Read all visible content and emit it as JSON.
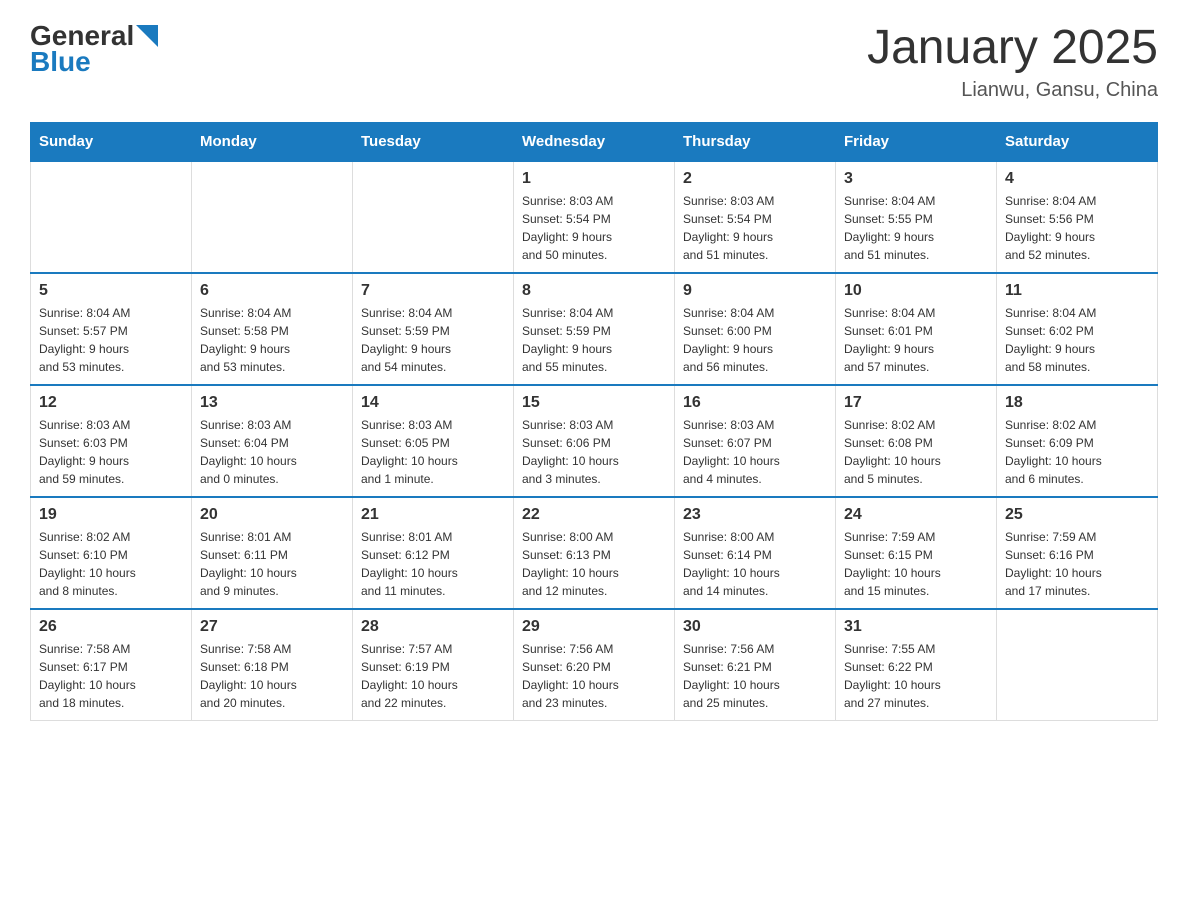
{
  "header": {
    "logo_general": "General",
    "logo_blue": "Blue",
    "title": "January 2025",
    "subtitle": "Lianwu, Gansu, China"
  },
  "days_of_week": [
    "Sunday",
    "Monday",
    "Tuesday",
    "Wednesday",
    "Thursday",
    "Friday",
    "Saturday"
  ],
  "weeks": [
    [
      {
        "day": "",
        "info": ""
      },
      {
        "day": "",
        "info": ""
      },
      {
        "day": "",
        "info": ""
      },
      {
        "day": "1",
        "info": "Sunrise: 8:03 AM\nSunset: 5:54 PM\nDaylight: 9 hours\nand 50 minutes."
      },
      {
        "day": "2",
        "info": "Sunrise: 8:03 AM\nSunset: 5:54 PM\nDaylight: 9 hours\nand 51 minutes."
      },
      {
        "day": "3",
        "info": "Sunrise: 8:04 AM\nSunset: 5:55 PM\nDaylight: 9 hours\nand 51 minutes."
      },
      {
        "day": "4",
        "info": "Sunrise: 8:04 AM\nSunset: 5:56 PM\nDaylight: 9 hours\nand 52 minutes."
      }
    ],
    [
      {
        "day": "5",
        "info": "Sunrise: 8:04 AM\nSunset: 5:57 PM\nDaylight: 9 hours\nand 53 minutes."
      },
      {
        "day": "6",
        "info": "Sunrise: 8:04 AM\nSunset: 5:58 PM\nDaylight: 9 hours\nand 53 minutes."
      },
      {
        "day": "7",
        "info": "Sunrise: 8:04 AM\nSunset: 5:59 PM\nDaylight: 9 hours\nand 54 minutes."
      },
      {
        "day": "8",
        "info": "Sunrise: 8:04 AM\nSunset: 5:59 PM\nDaylight: 9 hours\nand 55 minutes."
      },
      {
        "day": "9",
        "info": "Sunrise: 8:04 AM\nSunset: 6:00 PM\nDaylight: 9 hours\nand 56 minutes."
      },
      {
        "day": "10",
        "info": "Sunrise: 8:04 AM\nSunset: 6:01 PM\nDaylight: 9 hours\nand 57 minutes."
      },
      {
        "day": "11",
        "info": "Sunrise: 8:04 AM\nSunset: 6:02 PM\nDaylight: 9 hours\nand 58 minutes."
      }
    ],
    [
      {
        "day": "12",
        "info": "Sunrise: 8:03 AM\nSunset: 6:03 PM\nDaylight: 9 hours\nand 59 minutes."
      },
      {
        "day": "13",
        "info": "Sunrise: 8:03 AM\nSunset: 6:04 PM\nDaylight: 10 hours\nand 0 minutes."
      },
      {
        "day": "14",
        "info": "Sunrise: 8:03 AM\nSunset: 6:05 PM\nDaylight: 10 hours\nand 1 minute."
      },
      {
        "day": "15",
        "info": "Sunrise: 8:03 AM\nSunset: 6:06 PM\nDaylight: 10 hours\nand 3 minutes."
      },
      {
        "day": "16",
        "info": "Sunrise: 8:03 AM\nSunset: 6:07 PM\nDaylight: 10 hours\nand 4 minutes."
      },
      {
        "day": "17",
        "info": "Sunrise: 8:02 AM\nSunset: 6:08 PM\nDaylight: 10 hours\nand 5 minutes."
      },
      {
        "day": "18",
        "info": "Sunrise: 8:02 AM\nSunset: 6:09 PM\nDaylight: 10 hours\nand 6 minutes."
      }
    ],
    [
      {
        "day": "19",
        "info": "Sunrise: 8:02 AM\nSunset: 6:10 PM\nDaylight: 10 hours\nand 8 minutes."
      },
      {
        "day": "20",
        "info": "Sunrise: 8:01 AM\nSunset: 6:11 PM\nDaylight: 10 hours\nand 9 minutes."
      },
      {
        "day": "21",
        "info": "Sunrise: 8:01 AM\nSunset: 6:12 PM\nDaylight: 10 hours\nand 11 minutes."
      },
      {
        "day": "22",
        "info": "Sunrise: 8:00 AM\nSunset: 6:13 PM\nDaylight: 10 hours\nand 12 minutes."
      },
      {
        "day": "23",
        "info": "Sunrise: 8:00 AM\nSunset: 6:14 PM\nDaylight: 10 hours\nand 14 minutes."
      },
      {
        "day": "24",
        "info": "Sunrise: 7:59 AM\nSunset: 6:15 PM\nDaylight: 10 hours\nand 15 minutes."
      },
      {
        "day": "25",
        "info": "Sunrise: 7:59 AM\nSunset: 6:16 PM\nDaylight: 10 hours\nand 17 minutes."
      }
    ],
    [
      {
        "day": "26",
        "info": "Sunrise: 7:58 AM\nSunset: 6:17 PM\nDaylight: 10 hours\nand 18 minutes."
      },
      {
        "day": "27",
        "info": "Sunrise: 7:58 AM\nSunset: 6:18 PM\nDaylight: 10 hours\nand 20 minutes."
      },
      {
        "day": "28",
        "info": "Sunrise: 7:57 AM\nSunset: 6:19 PM\nDaylight: 10 hours\nand 22 minutes."
      },
      {
        "day": "29",
        "info": "Sunrise: 7:56 AM\nSunset: 6:20 PM\nDaylight: 10 hours\nand 23 minutes."
      },
      {
        "day": "30",
        "info": "Sunrise: 7:56 AM\nSunset: 6:21 PM\nDaylight: 10 hours\nand 25 minutes."
      },
      {
        "day": "31",
        "info": "Sunrise: 7:55 AM\nSunset: 6:22 PM\nDaylight: 10 hours\nand 27 minutes."
      },
      {
        "day": "",
        "info": ""
      }
    ]
  ]
}
